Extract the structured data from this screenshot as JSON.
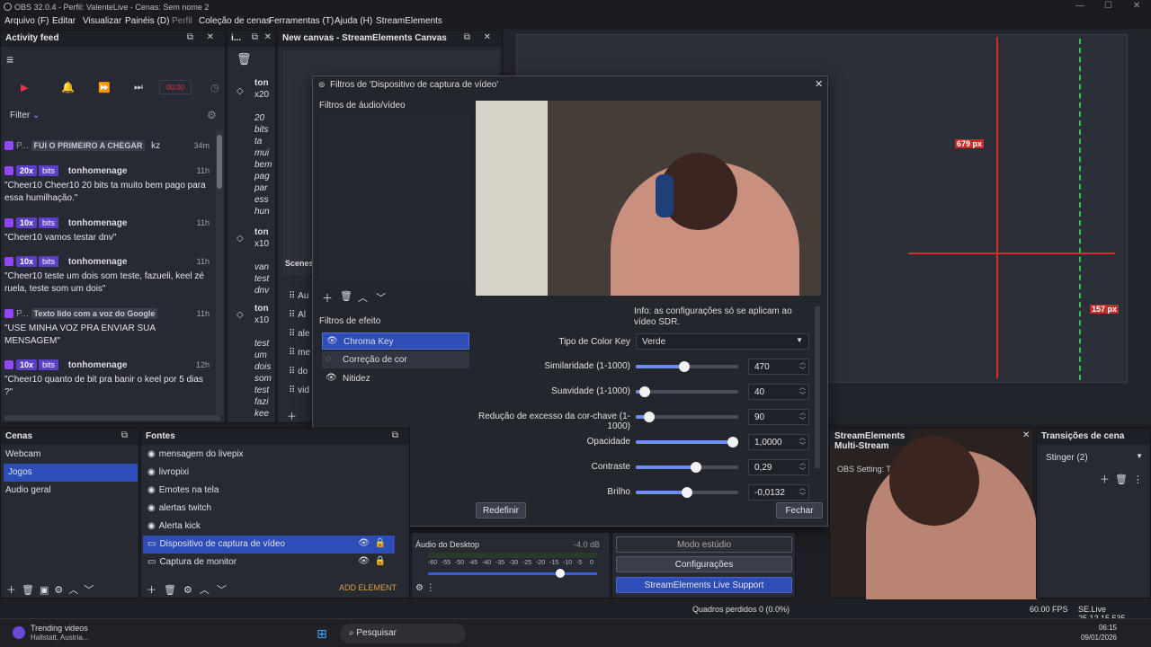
{
  "titlebar": {
    "title": "OBS 32.0.4 - Perfil: ValenteLive - Cenas: Sem nome 2"
  },
  "menu": [
    "Arquivo (F)",
    "Editar",
    "Visualizar",
    "Painéis (D)",
    "Perfil",
    "Coleção de cenas",
    "Ferramentas (T)",
    "Ajuda (H)",
    "StreamElements"
  ],
  "activity": {
    "title": "Activity feed",
    "filter": "Filter",
    "counter": "00:00",
    "items": [
      {
        "badge": "FUI O PRIMEIRO A CHEGAR",
        "prefix": "P...",
        "user": "kz",
        "time": "34m"
      },
      {
        "bits": "20x",
        "bits_label": "bits",
        "user": "tonhomenage",
        "time": "11h",
        "msg": "\"Cheer10 Cheer10 20 bits ta muito bem pago para essa humilhação.\""
      },
      {
        "bits": "10x",
        "bits_label": "bits",
        "user": "tonhomenage",
        "time": "11h",
        "msg": "\"Cheer10 vamos testar dnv\""
      },
      {
        "bits": "10x",
        "bits_label": "bits",
        "user": "tonhomenage",
        "time": "11h",
        "msg": "\"Cheer10 teste um dois som teste, fazueli, keel zé ruela, teste som um dois\""
      },
      {
        "badge": "Texto lido com a voz do Google",
        "prefix": "P...",
        "time": "11h",
        "msg": "\"USE MINHA VOZ PRA ENVIAR SUA MENSAGEM\""
      },
      {
        "bits": "10x",
        "bits_label": "bits",
        "user": "tonhomenage",
        "time": "12h",
        "msg": "\"Cheer10 quanto de bit pra banir o keel por 5 dias ?\""
      }
    ]
  },
  "narrow": {
    "items": [
      {
        "user": "ton",
        "bits": "x20",
        "lines": [
          "20",
          "bits",
          "ta",
          "mui",
          "bem",
          "pag",
          "par",
          "ess",
          "hun"
        ]
      },
      {
        "user": "ton",
        "bits": "x10",
        "lines": [
          "van",
          "test",
          "dnv"
        ]
      },
      {
        "user": "ton",
        "bits": "x10",
        "lines": [
          "test",
          "um",
          "dois",
          "som",
          "test",
          "fazi",
          "kee"
        ]
      }
    ]
  },
  "canvas": {
    "title": "New canvas - StreamElements Canvas",
    "scenes_label": "Scenes",
    "scene_rows": [
      "Au",
      "Al",
      "ale",
      "me",
      "do",
      "vid"
    ]
  },
  "dialog": {
    "title": "Filtros de 'Dispositivo de captura de vídeo'",
    "audio_video_label": "Filtros de áudio/vídeo",
    "effects_label": "Filtros de efeito",
    "filters": [
      "Chroma Key",
      "Correção de cor",
      "Nitidez"
    ],
    "info": "Info: as configurações só se aplicam ao vídeo SDR.",
    "key_type_label": "Tipo de Color Key",
    "key_type_value": "Verde",
    "sliders": [
      {
        "label": "Similaridade (1-1000)",
        "value": "470",
        "level": 0.47
      },
      {
        "label": "Suavidade (1-1000)",
        "value": "40",
        "level": 0.04
      },
      {
        "label": "Redução de excesso da cor-chave (1-1000)",
        "value": "90",
        "level": 0.09
      },
      {
        "label": "Opacidade",
        "value": "1,0000",
        "level": 1.0
      },
      {
        "label": "Contraste",
        "value": "0,29",
        "level": 0.6
      },
      {
        "label": "Brilho",
        "value": "-0,0132",
        "level": 0.5
      }
    ],
    "reset": "Redefinir",
    "close": "Fechar"
  },
  "scenes": {
    "title": "Cenas",
    "items": [
      "Webcam",
      "Jogos",
      "Audio geral"
    ],
    "selected": 1
  },
  "sources": {
    "title": "Fontes",
    "items": [
      "mensagem do livepix",
      "livropixi",
      "Emotes na tela",
      "alertas twitch",
      "Alerta kick",
      "Dispositivo de captura de vídeo",
      "Captura de monitor"
    ],
    "selected": 5,
    "add_element": "ADD ELEMENT"
  },
  "mixer": {
    "source": "Áudio do Desktop",
    "level": "-4.0 dB",
    "ticks": [
      "-60",
      "-55",
      "-50",
      "-45",
      "-40",
      "-35",
      "-30",
      "-25",
      "-20",
      "-15",
      "-10",
      "-5",
      "0"
    ]
  },
  "controls": {
    "studio": "Modo estúdio",
    "settings": "Configurações",
    "support": "StreamElements Live Support"
  },
  "multistream": {
    "title": "StreamElements Multi-Stream",
    "setting": "OBS Setting: T"
  },
  "transitions": {
    "title": "Transições de cena",
    "value": "Stinger (2)"
  },
  "status": {
    "dropped": "Quadros perdidos 0 (0.0%)",
    "fps": "60.00 FPS",
    "version": "SE.Live 25.12.15.535"
  },
  "preview_overlay": {
    "px1": "679 px",
    "px2": "157 px"
  },
  "taskbar": {
    "weather_title": "Trending videos",
    "weather_sub": "Hallstatt, Austria...",
    "search": "Pesquisar",
    "time": "06:15",
    "date": "09/01/2026"
  },
  "colors": {
    "accent": "#2f4db7",
    "bits": "#5b3fc7",
    "twitch": "#9146ff",
    "support": "#2f4db7"
  }
}
